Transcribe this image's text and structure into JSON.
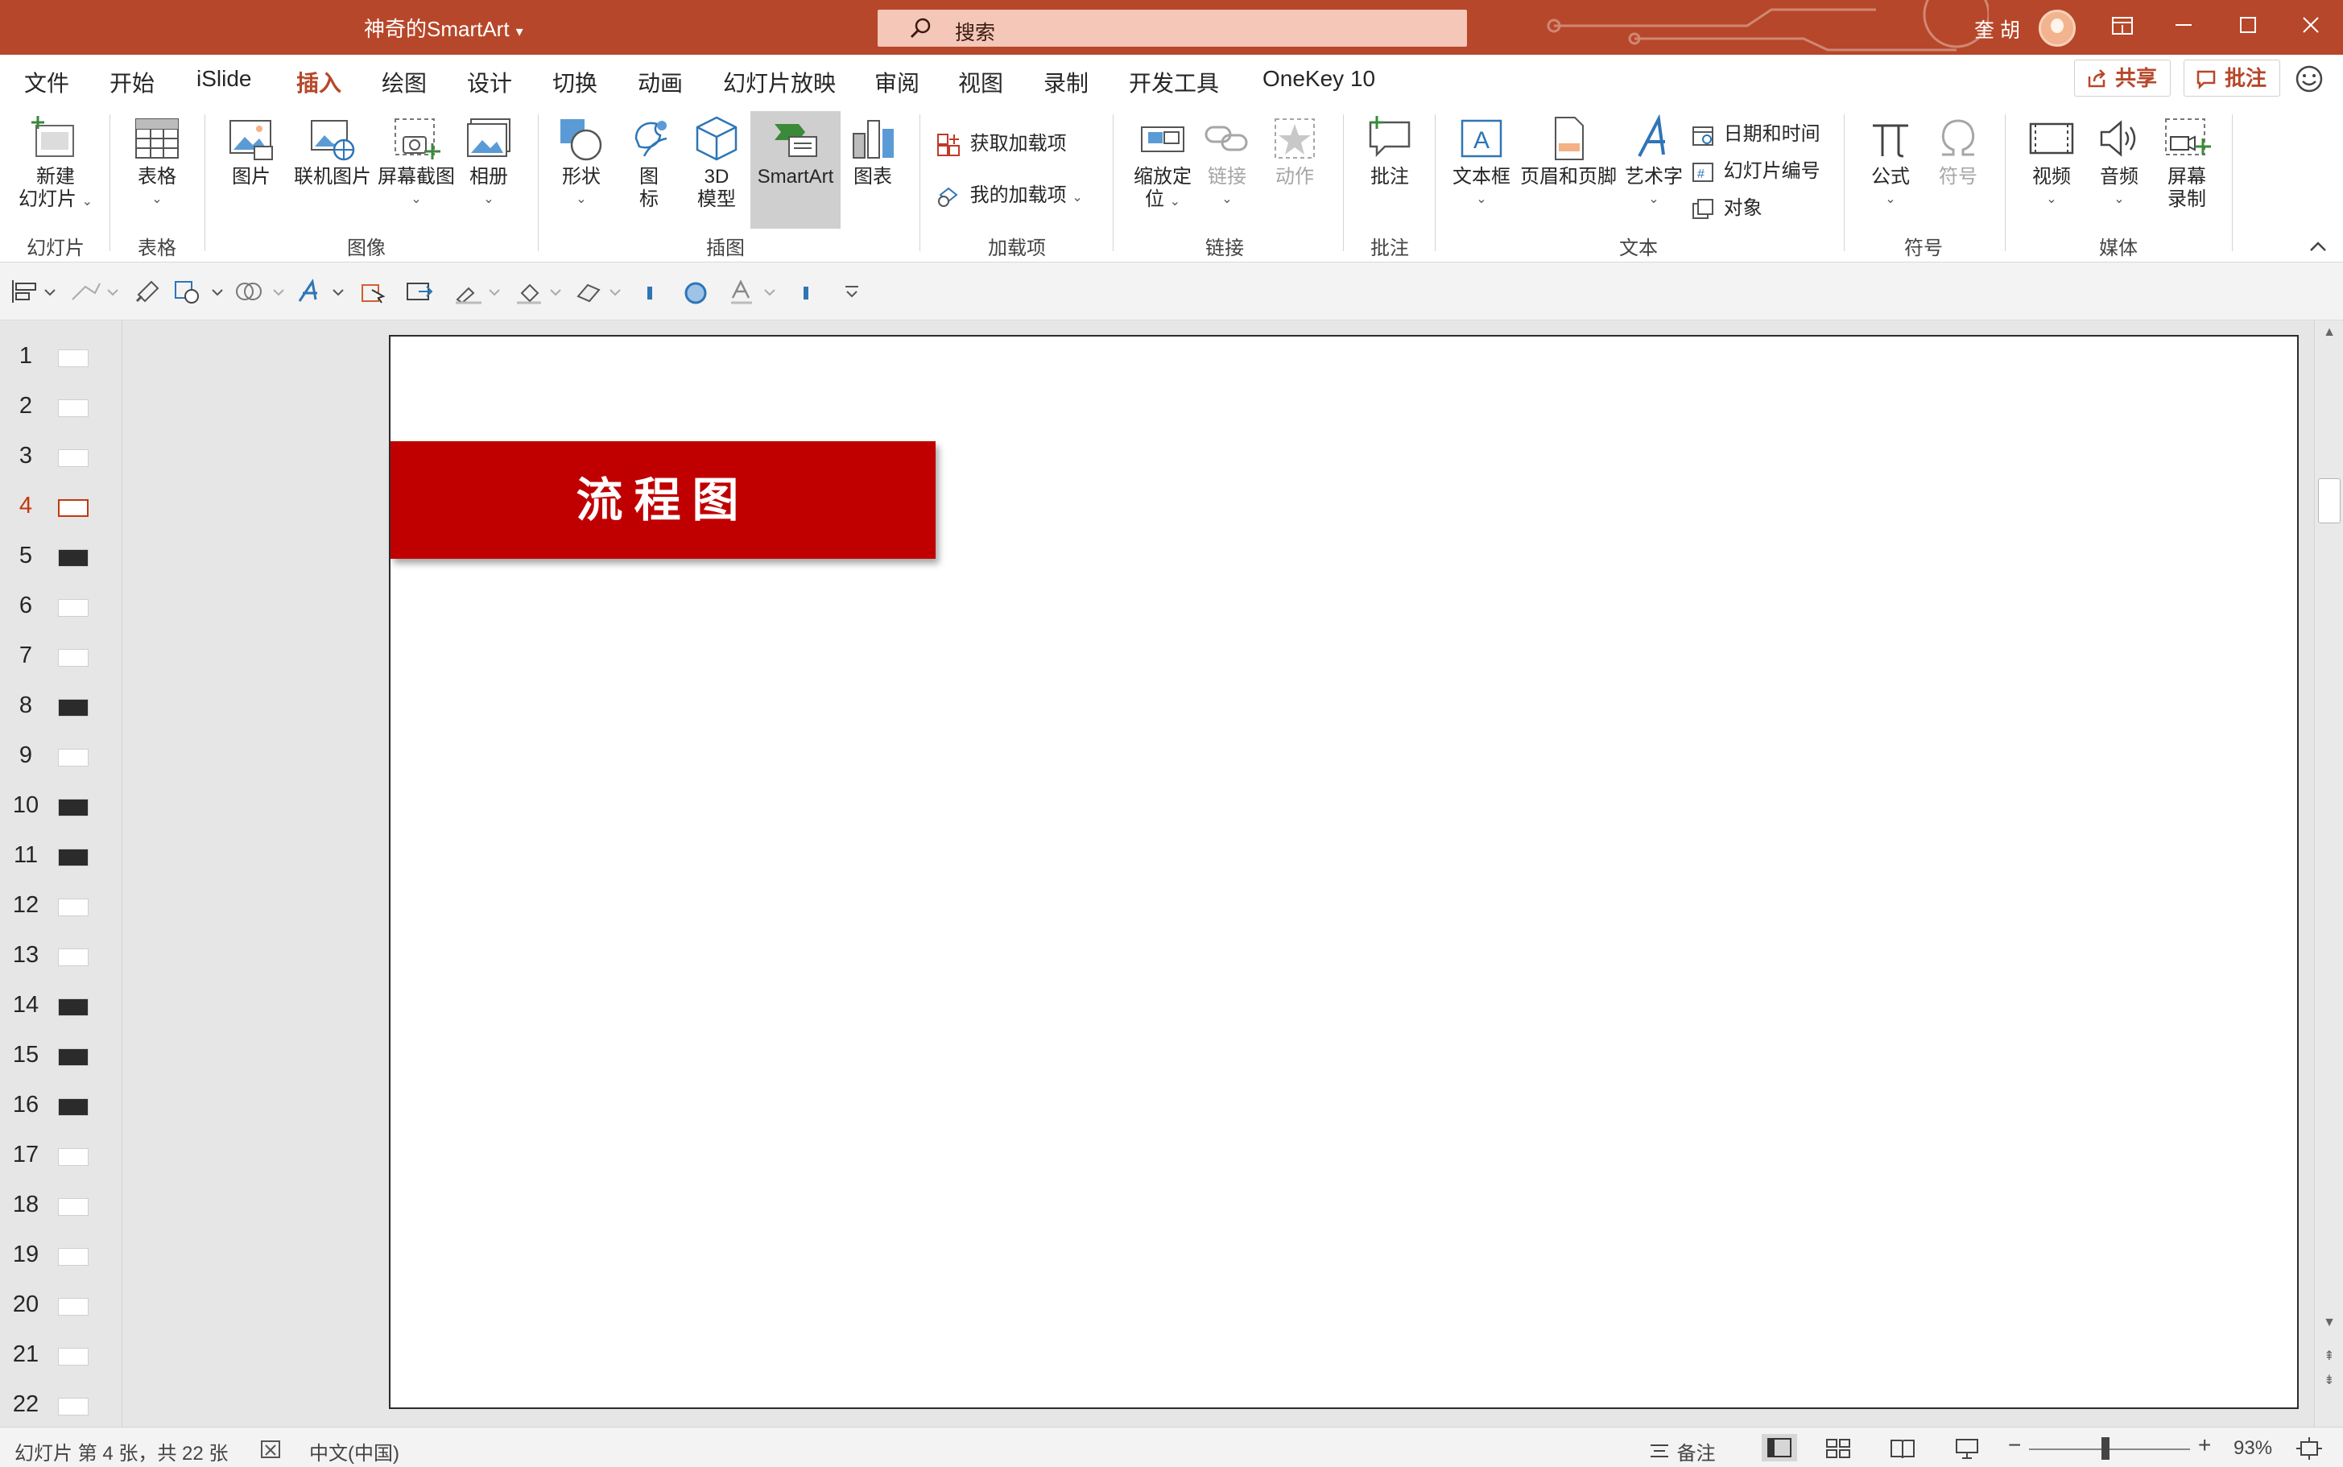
{
  "title_bar": {
    "doc_title": "神奇的SmartArt",
    "search_placeholder": "搜索",
    "user_name": "奎 胡",
    "window_buttons": [
      "ribbon-display-icon",
      "minimize-icon",
      "maximize-icon",
      "close-icon"
    ]
  },
  "menu": {
    "tabs": [
      "文件",
      "开始",
      "iSlide",
      "插入",
      "绘图",
      "设计",
      "切换",
      "动画",
      "幻灯片放映",
      "审阅",
      "视图",
      "录制",
      "开发工具",
      "OneKey 10"
    ],
    "active_tab": "插入",
    "share_label": "共享",
    "comment_label": "批注"
  },
  "ribbon": {
    "groups": {
      "slides": "幻灯片",
      "tables": "表格",
      "images": "图像",
      "illustrations": "插图",
      "addins": "加载项",
      "links": "链接",
      "comments": "批注",
      "text": "文本",
      "symbols": "符号",
      "media": "媒体"
    },
    "buttons": {
      "new_slide_1": "新建",
      "new_slide_2": "幻灯片",
      "table": "表格",
      "picture": "图片",
      "online_picture": "联机图片",
      "screenshot": "屏幕截图",
      "album": "相册",
      "shapes": "形状",
      "icons_1": "图",
      "icons_2": "标",
      "model3d_1": "3D",
      "model3d_2": "模型",
      "smartart": "SmartArt",
      "chart": "图表",
      "get_addins": "获取加载项",
      "my_addins": "我的加载项",
      "zoom_1": "缩放定",
      "zoom_2": "位",
      "link": "链接",
      "action": "动作",
      "comment": "批注",
      "textbox": "文本框",
      "header_footer": "页眉和页脚",
      "wordart": "艺术字",
      "date_time": "日期和时间",
      "slide_number": "幻灯片编号",
      "object": "对象",
      "equation": "公式",
      "symbol": "符号",
      "video": "视频",
      "audio": "音频",
      "screen_rec_1": "屏幕",
      "screen_rec_2": "录制"
    }
  },
  "thumbnails": [
    "1",
    "2",
    "3",
    "4",
    "5",
    "6",
    "7",
    "8",
    "9",
    "10",
    "11",
    "12",
    "13",
    "14",
    "15",
    "16",
    "17",
    "18",
    "19",
    "20",
    "21",
    "22"
  ],
  "active_slide_index": 4,
  "slide": {
    "banner_text": "流程图",
    "banner_color": "#c00000"
  },
  "status": {
    "slide_info": "幻灯片 第 4 张，共 22 张",
    "language": "中文(中国)",
    "notes": "备注",
    "zoom": "93%"
  },
  "colors": {
    "accent": "#b7472a",
    "banner": "#c00000"
  }
}
